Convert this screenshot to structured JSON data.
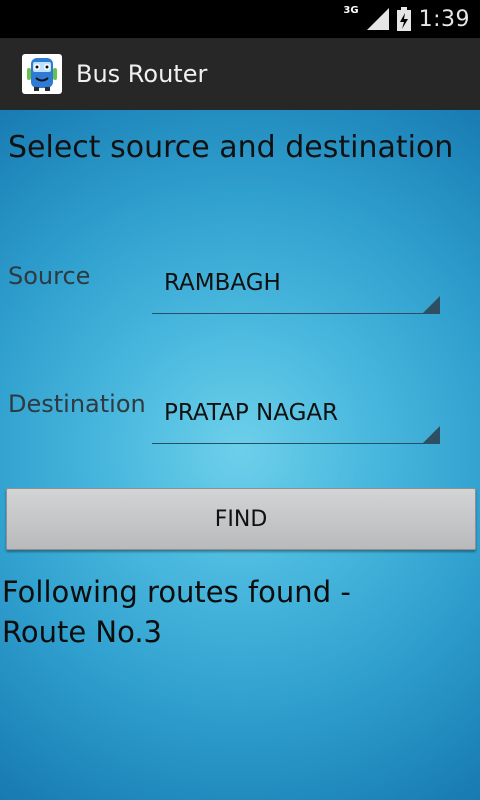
{
  "status_bar": {
    "network": "3G",
    "time": "1:39",
    "icons": [
      "signal-icon",
      "battery-icon"
    ]
  },
  "action_bar": {
    "title": "Bus Router",
    "icon": "bus-app-icon"
  },
  "main": {
    "heading": "Select source and destination",
    "source": {
      "label": "Source",
      "value": "RAMBAGH"
    },
    "destination": {
      "label": "Destination",
      "value": "PRATAP NAGAR"
    },
    "find_button": "FIND",
    "result": {
      "line1": "Following routes found -",
      "line2": "Route No.3"
    }
  },
  "colors": {
    "action_bar": "#272727",
    "background_center": "#6dd0ea",
    "background_edge": "#11679c",
    "button": "#c5c7c8"
  }
}
